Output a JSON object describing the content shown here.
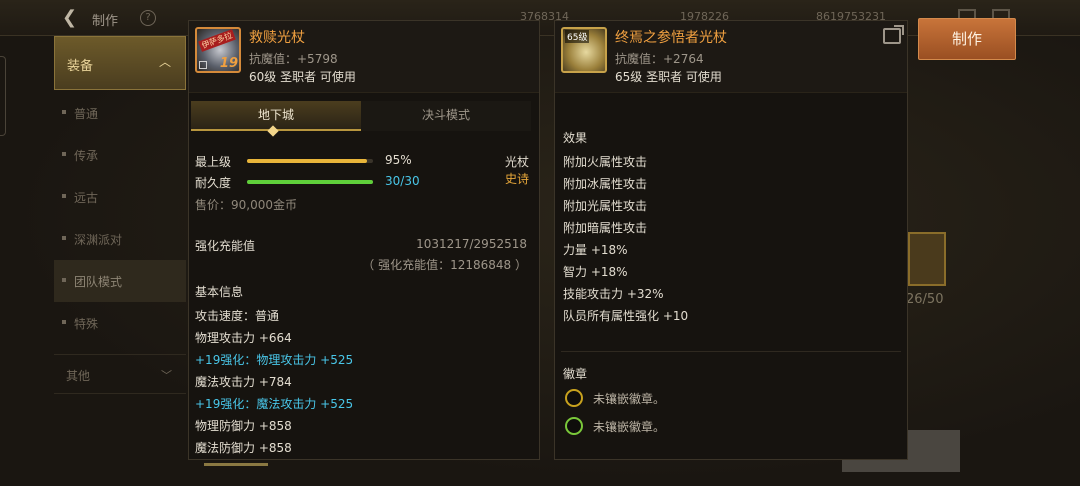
{
  "topbar": {
    "title": "制作",
    "help": "?",
    "currency": [
      "3768314",
      "1978226",
      "8619753231"
    ]
  },
  "sidebar": {
    "header": "装备",
    "items": [
      {
        "label": "普通"
      },
      {
        "label": "传承"
      },
      {
        "label": "远古"
      },
      {
        "label": "深渊派对"
      },
      {
        "label": "团队模式"
      },
      {
        "label": "特殊"
      }
    ],
    "other": "其他"
  },
  "craft_button": "制作",
  "right_count": "26/50",
  "left_panel": {
    "name": "救赎光杖",
    "icon_tag": "伊萨多拉",
    "icon_level": "19",
    "resist": "抗魔值：+5798",
    "requirement": "60级 圣职者 可使用",
    "tabs": [
      "地下城",
      "决斗模式"
    ],
    "grade_label": "最上级",
    "grade_value": "95%",
    "grade_percent": 95,
    "durability_label": "耐久度",
    "durability_value": "30/30",
    "durability_percent": 100,
    "item_type": "光杖",
    "rarity": "史诗",
    "price": "售价：90,000金币",
    "charge_label": "强化充能值",
    "charge_value": "1031217/2952518",
    "charge_total": "（ 强化充能值：12186848 ）",
    "basic_title": "基本信息",
    "stats": [
      {
        "text": "攻击速度：普通",
        "type": "normal"
      },
      {
        "text": "物理攻击力 +664",
        "type": "normal"
      },
      {
        "text": "+19强化：物理攻击力 +525",
        "type": "cyan"
      },
      {
        "text": "魔法攻击力 +784",
        "type": "normal"
      },
      {
        "text": "+19强化：魔法攻击力 +525",
        "type": "cyan"
      },
      {
        "text": "物理防御力 +858",
        "type": "normal"
      },
      {
        "text": "魔法防御力 +858",
        "type": "normal"
      }
    ],
    "colors": {
      "grade_bar": "#e8b53a",
      "durability_bar": "#5fcf3a",
      "durability_text": "#49c6e8",
      "rarity": "#e8a83a"
    }
  },
  "right_panel": {
    "name": "终焉之参悟者光杖",
    "icon_level": "65级",
    "resist": "抗魔值：+2764",
    "requirement": "65级 圣职者 可使用",
    "effects_title": "效果",
    "effects": [
      "附加火属性攻击",
      "附加冰属性攻击",
      "附加光属性攻击",
      "附加暗属性攻击",
      "力量 +18%",
      "智力 +18%",
      "技能攻击力 +32%",
      "队员所有属性强化 +10"
    ],
    "emblem_title": "徽章",
    "emblems": [
      {
        "text": "未镶嵌徽章。",
        "color": "#c8a21e"
      },
      {
        "text": "未镶嵌徽章。",
        "color": "#7ac83a"
      }
    ]
  }
}
